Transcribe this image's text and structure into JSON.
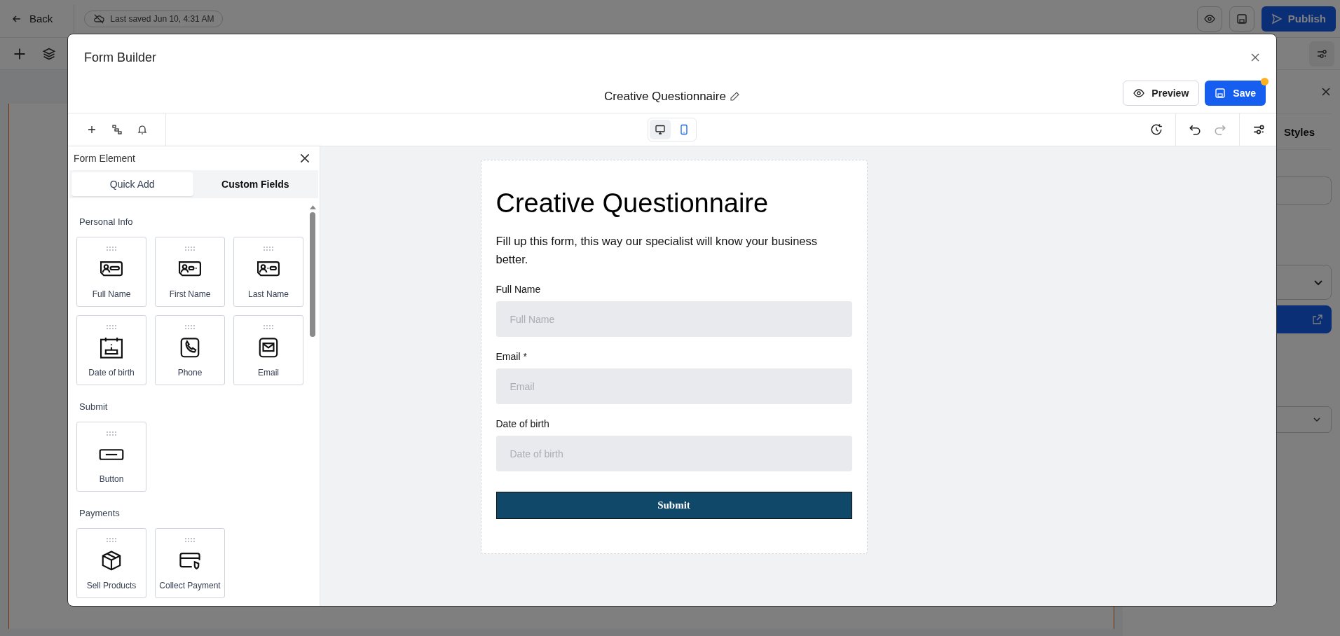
{
  "app": {
    "back": "Back",
    "last_saved": "Last saved Jun 10, 4:31 AM",
    "publish": "Publish",
    "side_panel_tab": "Styles"
  },
  "modal": {
    "title": "Form Builder",
    "form_name": "Creative Questionnaire",
    "preview": "Preview",
    "save": "Save",
    "unsaved": true,
    "devices": [
      {
        "kind": "desktop",
        "selected": true
      },
      {
        "kind": "mobile",
        "selected": false
      }
    ],
    "undo": {
      "disabled": false
    },
    "redo": {
      "disabled": true
    }
  },
  "panel": {
    "title": "Form Element",
    "tabs": [
      {
        "label": "Quick Add",
        "selected": true
      },
      {
        "label": "Custom Fields",
        "selected": false
      }
    ],
    "sections": [
      {
        "title": "Personal Info",
        "items": [
          {
            "label": "Full Name",
            "kind": "full-name"
          },
          {
            "label": "First Name",
            "kind": "first-name"
          },
          {
            "label": "Last Name",
            "kind": "last-name"
          },
          {
            "label": "Date of birth",
            "kind": "birthday"
          },
          {
            "label": "Phone",
            "kind": "phone"
          },
          {
            "label": "Email",
            "kind": "email"
          }
        ]
      },
      {
        "title": "Submit",
        "items": [
          {
            "label": "Button",
            "kind": "button"
          }
        ]
      },
      {
        "title": "Payments",
        "items": [
          {
            "label": "Sell Products",
            "kind": "product"
          },
          {
            "label": "Collect Payment",
            "kind": "payment"
          }
        ]
      }
    ]
  },
  "form": {
    "heading": "Creative Questionnaire",
    "description": "Fill up this form, this way our specialist will know your business better.",
    "fields": [
      {
        "label": "Full Name",
        "placeholder": "Full Name"
      },
      {
        "label": "Email *",
        "placeholder": "Email"
      },
      {
        "label": "Date of birth",
        "placeholder": "Date of birth"
      }
    ],
    "submit": "Submit"
  }
}
